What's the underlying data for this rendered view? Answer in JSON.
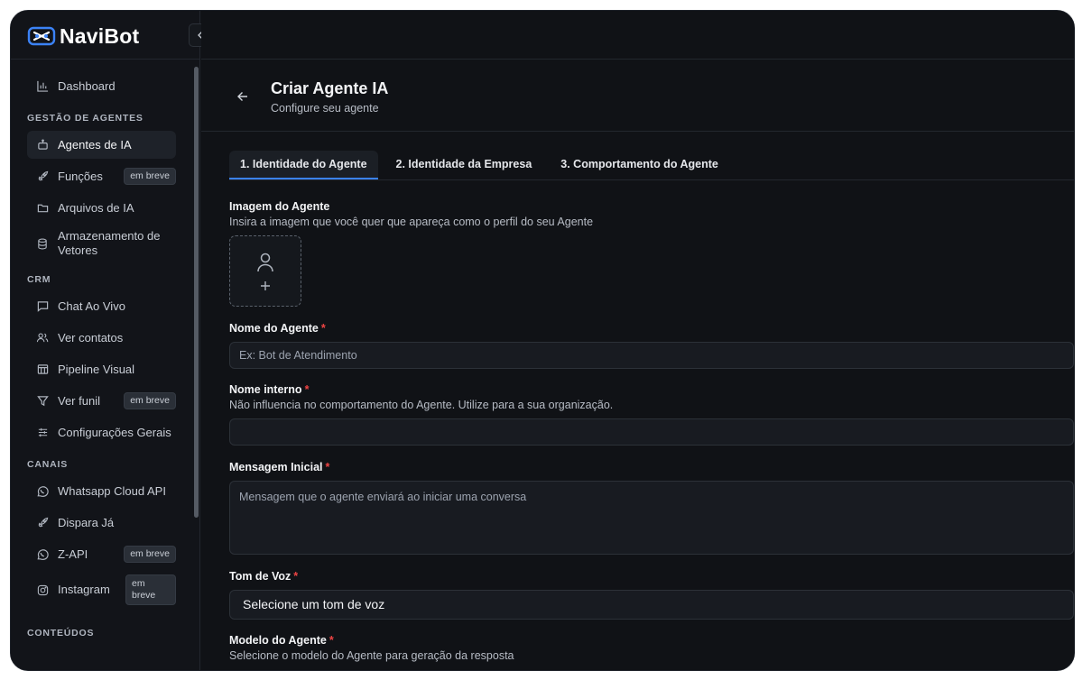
{
  "brand": {
    "name": "NaviBot",
    "accent": "#3b82f6"
  },
  "sidebar": {
    "dashboard": "Dashboard",
    "sections": {
      "gestao": "GESTÃO DE AGENTES",
      "crm": "CRM",
      "canais": "CANAIS",
      "conteudos": "CONTEÚDOS"
    },
    "gestao_items": [
      {
        "label": "Agentes de IA",
        "icon": "bot-icon"
      },
      {
        "label": "Funções",
        "icon": "rocket-icon",
        "badge": "em breve"
      },
      {
        "label": "Arquivos de IA",
        "icon": "folder-icon"
      },
      {
        "label": "Armazenamento de Vetores",
        "icon": "database-icon"
      }
    ],
    "crm_items": [
      {
        "label": "Chat Ao Vivo",
        "icon": "chat-icon"
      },
      {
        "label": "Ver contatos",
        "icon": "users-icon"
      },
      {
        "label": "Pipeline Visual",
        "icon": "kanban-icon"
      },
      {
        "label": "Ver funil",
        "icon": "funnel-icon",
        "badge": "em breve"
      },
      {
        "label": "Configurações Gerais",
        "icon": "sliders-icon"
      }
    ],
    "canais_items": [
      {
        "label": "Whatsapp Cloud API",
        "icon": "whatsapp-icon"
      },
      {
        "label": "Dispara Já",
        "icon": "rocket-icon"
      },
      {
        "label": "Z-API",
        "icon": "whatsapp-icon",
        "badge": "em breve"
      },
      {
        "label": "Instagram",
        "icon": "instagram-icon",
        "badge": "em breve"
      }
    ]
  },
  "header": {
    "title": "Criar Agente IA",
    "subtitle": "Configure seu agente"
  },
  "tabs": [
    "1. Identidade do Agente",
    "2. Identidade da Empresa",
    "3. Comportamento do Agente"
  ],
  "form": {
    "image": {
      "label": "Imagem do Agente",
      "help": "Insira a imagem que você quer que apareça como o perfil do seu Agente"
    },
    "name": {
      "label": "Nome do Agente",
      "required": "*",
      "placeholder": "Ex: Bot de Atendimento"
    },
    "internal_name": {
      "label": "Nome interno",
      "required": "*",
      "help": "Não influencia no comportamento do Agente. Utilize para a sua organização.",
      "placeholder": ""
    },
    "initial_message": {
      "label": "Mensagem Inicial",
      "required": "*",
      "placeholder": "Mensagem que o agente enviará ao iniciar uma conversa"
    },
    "tone": {
      "label": "Tom de Voz",
      "required": "*",
      "value": "Selecione um tom de voz"
    },
    "model": {
      "label": "Modelo do Agente",
      "required": "*",
      "help": "Selecione o modelo do Agente para geração da resposta"
    }
  }
}
